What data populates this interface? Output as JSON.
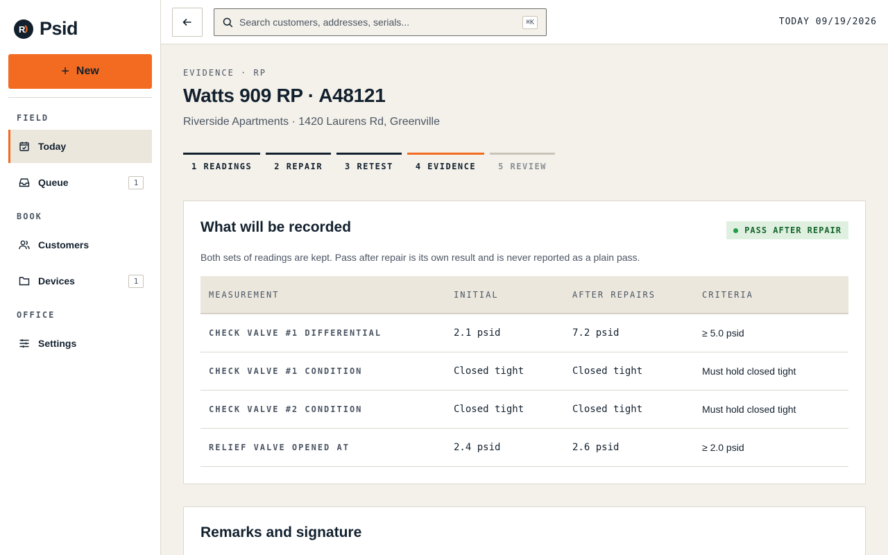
{
  "brand": {
    "name": "Psid"
  },
  "sidebar": {
    "new_label": "New",
    "sections": [
      {
        "label": "FIELD"
      },
      {
        "label": "BOOK"
      },
      {
        "label": "OFFICE"
      }
    ],
    "items": [
      {
        "label": "Today",
        "icon": "calendar-check-icon"
      },
      {
        "label": "Queue",
        "icon": "inbox-icon",
        "badge": "1"
      },
      {
        "label": "Customers",
        "icon": "users-icon"
      },
      {
        "label": "Devices",
        "icon": "folder-icon",
        "badge": "1"
      },
      {
        "label": "Settings",
        "icon": "sliders-icon"
      }
    ]
  },
  "topbar": {
    "search_placeholder": "Search customers, addresses, serials...",
    "shortcut": "⌘K",
    "today_label": "TODAY 09/19/2026"
  },
  "page": {
    "eyebrow": "EVIDENCE · RP",
    "title": "Watts 909 RP · A48121",
    "subtitle": "Riverside Apartments · 1420 Laurens Rd, Greenville"
  },
  "steps": [
    {
      "label": "1 READINGS",
      "state": "done"
    },
    {
      "label": "2 REPAIR",
      "state": "done"
    },
    {
      "label": "3 RETEST",
      "state": "done"
    },
    {
      "label": "4 EVIDENCE",
      "state": "active"
    },
    {
      "label": "5 REVIEW",
      "state": "pending"
    }
  ],
  "recorded_card": {
    "title": "What will be recorded",
    "badge": "PASS AFTER REPAIR",
    "description": "Both sets of readings are kept. Pass after repair is its own result and is never reported as a plain pass.",
    "columns": [
      "MEASUREMENT",
      "INITIAL",
      "AFTER REPAIRS",
      "CRITERIA"
    ],
    "rows": [
      [
        "CHECK VALVE #1 DIFFERENTIAL",
        "2.1 psid",
        "7.2 psid",
        "≥ 5.0 psid"
      ],
      [
        "CHECK VALVE #1 CONDITION",
        "Closed tight",
        "Closed tight",
        "Must hold closed tight"
      ],
      [
        "CHECK VALVE #2 CONDITION",
        "Closed tight",
        "Closed tight",
        "Must hold closed tight"
      ],
      [
        "RELIEF VALVE OPENED AT",
        "2.4 psid",
        "2.6 psid",
        "≥ 2.0 psid"
      ]
    ]
  },
  "remarks_card": {
    "title": "Remarks and signature"
  },
  "colors": {
    "accent": "#f26b21",
    "ink": "#12202e",
    "pass_green": "#1f9d47"
  }
}
